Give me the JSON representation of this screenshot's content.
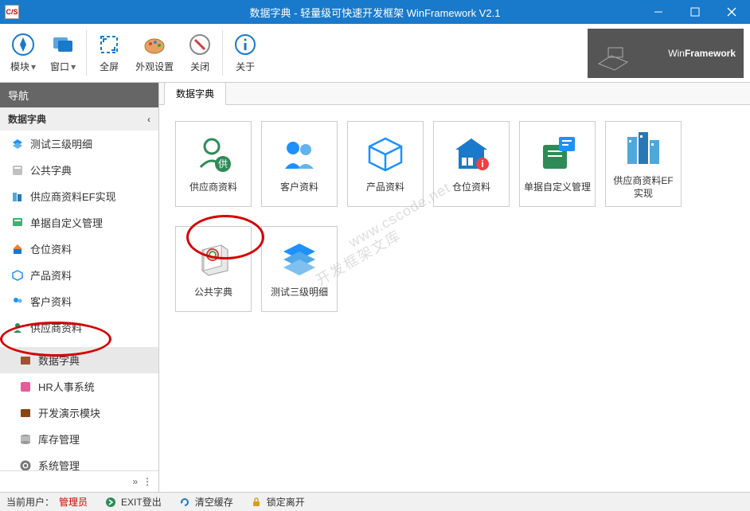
{
  "window": {
    "title": "数据字典 - 轻量级可快速开发框架 WinFramework V2.1",
    "app_icon": "C/S"
  },
  "ribbon": {
    "items": [
      {
        "label": "模块",
        "icon": "compass",
        "dropdown": true
      },
      {
        "label": "窗口",
        "icon": "windows",
        "dropdown": true
      },
      {
        "label": "全屏",
        "icon": "fullscreen"
      },
      {
        "label": "外观设置",
        "icon": "palette"
      },
      {
        "label": "关闭",
        "icon": "close-circle"
      },
      {
        "label": "关于",
        "icon": "info"
      }
    ]
  },
  "brand": {
    "light": "Win",
    "bold": "Framework"
  },
  "sidebar": {
    "title": "导航",
    "section": "数据字典",
    "items": [
      {
        "label": "测试三级明细",
        "icon": "layers-blue"
      },
      {
        "label": "公共字典",
        "icon": "book"
      },
      {
        "label": "供应商资料EF实现",
        "icon": "building"
      },
      {
        "label": "单据自定义管理",
        "icon": "form-green"
      },
      {
        "label": "仓位资料",
        "icon": "house-blue"
      },
      {
        "label": "产品资料",
        "icon": "cube-blue"
      },
      {
        "label": "客户资料",
        "icon": "people-blue"
      },
      {
        "label": "供应商资料",
        "icon": "person-green"
      }
    ],
    "modules": [
      {
        "label": "数据字典",
        "icon": "dict-brown",
        "active": true
      },
      {
        "label": "HR人事系统",
        "icon": "hr-pink"
      },
      {
        "label": "开发演示模块",
        "icon": "dev-brown"
      },
      {
        "label": "库存管理",
        "icon": "db-gray"
      },
      {
        "label": "系统管理",
        "icon": "gear-gray"
      }
    ]
  },
  "tab": {
    "label": "数据字典"
  },
  "tiles": [
    {
      "label": "供应商资料",
      "icon": "supplier"
    },
    {
      "label": "客户资料",
      "icon": "customers"
    },
    {
      "label": "产品资料",
      "icon": "product"
    },
    {
      "label": "仓位资料",
      "icon": "warehouse"
    },
    {
      "label": "单据自定义管理",
      "icon": "form"
    },
    {
      "label": "供应商资料EF实现",
      "icon": "buildings"
    },
    {
      "label": "公共字典",
      "icon": "dict"
    },
    {
      "label": "测试三级明细",
      "icon": "layers"
    }
  ],
  "status": {
    "user_label": "当前用户：",
    "user": "管理员",
    "exit": "EXIT登出",
    "clear": "清空缓存",
    "lock": "锁定离开"
  },
  "watermark1": "www.cscode.net",
  "watermark2": "开发框架文库"
}
